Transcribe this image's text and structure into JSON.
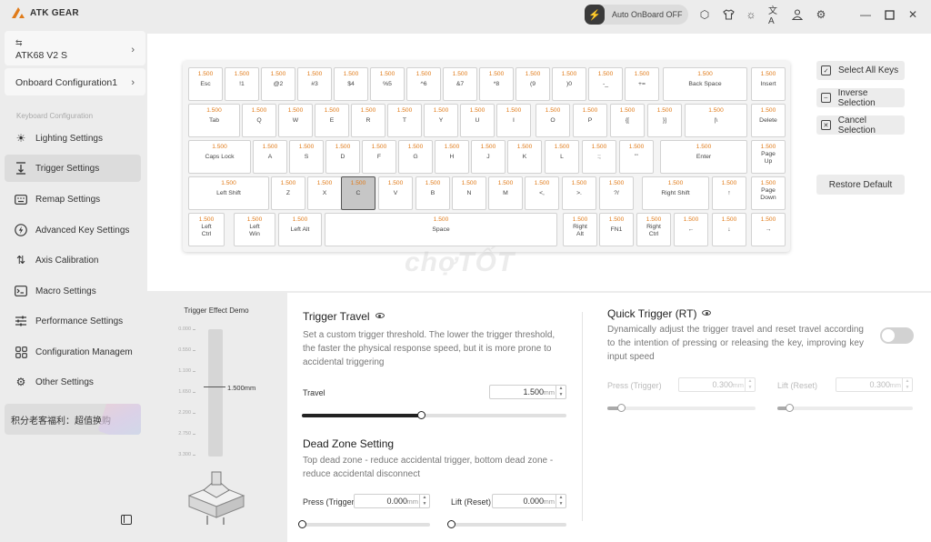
{
  "app": {
    "brand": "ATK GEAR",
    "auto_onboard": "Auto OnBoard OFF"
  },
  "device": {
    "name": "ATK68 V2 S",
    "config": "Onboard Configuration1"
  },
  "sidebar": {
    "section_label": "Keyboard Configuration",
    "items": [
      {
        "label": "Lighting Settings",
        "icon": "sun-icon"
      },
      {
        "label": "Trigger Settings",
        "icon": "trigger-icon"
      },
      {
        "label": "Remap Settings",
        "icon": "keyboard-icon"
      },
      {
        "label": "Advanced Key Settings",
        "icon": "bolt-icon"
      },
      {
        "label": "Axis Calibration",
        "icon": "sort-icon"
      },
      {
        "label": "Macro Settings",
        "icon": "terminal-icon"
      },
      {
        "label": "Performance Settings",
        "icon": "sliders-icon"
      },
      {
        "label": "Configuration Managem",
        "icon": "grid-icon"
      },
      {
        "label": "Other Settings",
        "icon": "gear-icon"
      }
    ],
    "promo": "积分老客福利：超值换购"
  },
  "keyboard": {
    "rows": [
      [
        [
          "1.500",
          "Esc"
        ],
        [
          "1.500",
          "!1"
        ],
        [
          "1.500",
          "@2"
        ],
        [
          "1.500",
          "#3"
        ],
        [
          "1.500",
          "$4"
        ],
        [
          "1.500",
          "%5"
        ],
        [
          "1.500",
          "^6"
        ],
        [
          "1.500",
          "&7"
        ],
        [
          "1.500",
          "*8"
        ],
        [
          "1.500",
          "(9"
        ],
        [
          "1.500",
          ")0"
        ],
        [
          "1.500",
          "-_"
        ],
        [
          "1.500",
          "+="
        ],
        [
          "1.500",
          "Back Space"
        ],
        [
          "1.500",
          "Insert"
        ]
      ],
      [
        [
          "1.500",
          "Tab"
        ],
        [
          "1.500",
          "Q"
        ],
        [
          "1.500",
          "W"
        ],
        [
          "1.500",
          "E"
        ],
        [
          "1.500",
          "R"
        ],
        [
          "1.500",
          "T"
        ],
        [
          "1.500",
          "Y"
        ],
        [
          "1.500",
          "U"
        ],
        [
          "1.500",
          "I"
        ],
        [
          "1.500",
          "O"
        ],
        [
          "1.500",
          "P"
        ],
        [
          "1.500",
          "{["
        ],
        [
          "1.500",
          "}]"
        ],
        [
          "1.500",
          "|\\"
        ],
        [
          "1.500",
          "Delete"
        ]
      ],
      [
        [
          "1.500",
          "Caps Lock"
        ],
        [
          "1.500",
          "A"
        ],
        [
          "1.500",
          "S"
        ],
        [
          "1.500",
          "D"
        ],
        [
          "1.500",
          "F"
        ],
        [
          "1.500",
          "G"
        ],
        [
          "1.500",
          "H"
        ],
        [
          "1.500",
          "J"
        ],
        [
          "1.500",
          "K"
        ],
        [
          "1.500",
          "L"
        ],
        [
          "1.500",
          ":;"
        ],
        [
          "1.500",
          "\"'"
        ],
        [
          "1.500",
          "Enter"
        ],
        [
          "1.500",
          "Page\nUp"
        ]
      ],
      [
        [
          "1.500",
          "Left Shift"
        ],
        [
          "1.500",
          "Z"
        ],
        [
          "1.500",
          "X"
        ],
        [
          "1.500",
          "C"
        ],
        [
          "1.500",
          "V"
        ],
        [
          "1.500",
          "B"
        ],
        [
          "1.500",
          "N"
        ],
        [
          "1.500",
          "M"
        ],
        [
          "1.500",
          "<,"
        ],
        [
          "1.500",
          ">."
        ],
        [
          "1.500",
          "?/"
        ],
        [
          "1.500",
          "Right Shift"
        ],
        [
          "1.500",
          "↑"
        ],
        [
          "1.500",
          "Page\nDown"
        ]
      ],
      [
        [
          "1.500",
          "Left\nCtrl"
        ],
        [
          "1.500",
          "Left\nWin"
        ],
        [
          "1.500",
          "Left Alt"
        ],
        [
          "1.500",
          "Space"
        ],
        [
          "1.500",
          "Right\nAlt"
        ],
        [
          "1.500",
          "FN1"
        ],
        [
          "1.500",
          "Right\nCtrl"
        ],
        [
          "1.500",
          "←"
        ],
        [
          "1.500",
          "↓"
        ],
        [
          "1.500",
          "→"
        ]
      ]
    ],
    "selected_key": "C"
  },
  "actions": {
    "select_all": "Select All Keys",
    "inverse": "Inverse Selection",
    "cancel": "Cancel Selection",
    "restore": "Restore Default"
  },
  "demo": {
    "title": "Trigger Effect Demo",
    "scale": [
      "0.000",
      "0.550",
      "1.100",
      "1.650",
      "2.200",
      "2.750",
      "3.300"
    ],
    "current": "1.500mm",
    "current_value": 1.5,
    "max": 3.3
  },
  "trigger_travel": {
    "title": "Trigger Travel",
    "desc": "Set a custom trigger threshold. The lower the trigger threshold, the faster the physical response speed, but it is more prone to accidental triggering",
    "label": "Travel",
    "value": "1.500",
    "unit": "mm",
    "fraction": 0.45
  },
  "dead_zone": {
    "title": "Dead Zone Setting",
    "desc": "Top dead zone - reduce accidental trigger, bottom dead zone - reduce accidental disconnect",
    "press_label": "Press (Trigger)",
    "press_value": "0.000",
    "lift_label": "Lift (Reset)",
    "lift_value": "0.000",
    "unit": "mm",
    "press_fraction": 0,
    "lift_fraction": 0
  },
  "quick_trigger": {
    "title": "Quick Trigger (RT)",
    "desc": "Dynamically adjust the trigger travel and reset travel according to the intention of pressing or releasing the key, improving key input speed",
    "enabled": false,
    "press_label": "Press (Trigger)",
    "press_value": "0.300",
    "lift_label": "Lift (Reset)",
    "lift_value": "0.300",
    "unit": "mm",
    "press_fraction": 0.09,
    "lift_fraction": 0.09
  },
  "colors": {
    "accent": "#e07b1a",
    "panel": "#ffffff",
    "sidebar": "#ececec"
  },
  "watermark": "chợTỐT"
}
